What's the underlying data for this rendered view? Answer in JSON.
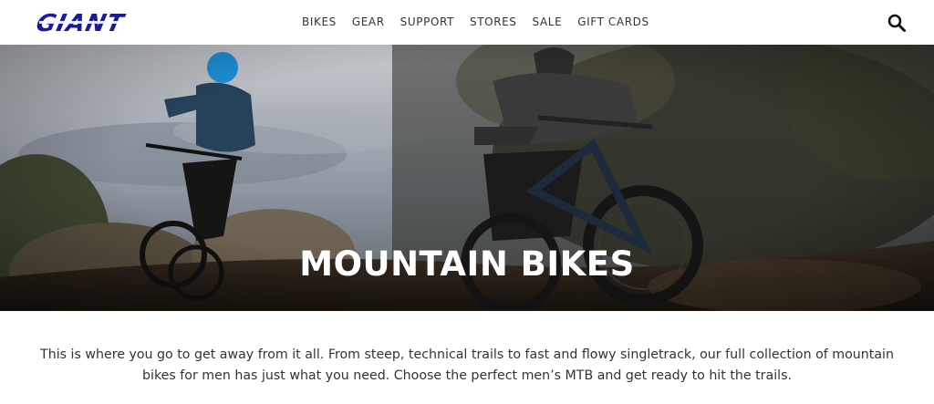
{
  "brand": {
    "logo_text": "GIANT",
    "logo_color": "#1a1a9e"
  },
  "nav": {
    "items": [
      {
        "label": "BIKES"
      },
      {
        "label": "GEAR"
      },
      {
        "label": "SUPPORT"
      },
      {
        "label": "STORES"
      },
      {
        "label": "SALE"
      },
      {
        "label": "GIFT CARDS"
      }
    ]
  },
  "header": {
    "search_icon": "search-icon"
  },
  "hero": {
    "title": "MOUNTAIN BIKES"
  },
  "intro": {
    "text": "This is where you go to get away from it all. From steep, technical trails to fast and flowy singletrack, our full collection of mountain bikes for men has just what you need. Choose the perfect men’s MTB and get ready to hit the trails."
  }
}
